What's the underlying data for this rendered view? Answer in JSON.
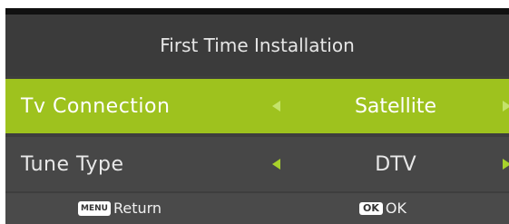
{
  "header": {
    "title": "First Time Installation"
  },
  "rows": [
    {
      "label": "Tv Connection",
      "value": "Satellite",
      "selected": true
    },
    {
      "label": "Tune Type",
      "value": "DTV",
      "selected": false
    }
  ],
  "footer": {
    "return_key": "MENU",
    "return_label": "Return",
    "ok_key": "OK",
    "ok_label": "OK"
  },
  "colors": {
    "highlight": "#9ec21e",
    "arrow": "#a8d22b",
    "background": "#3e3e3e"
  }
}
